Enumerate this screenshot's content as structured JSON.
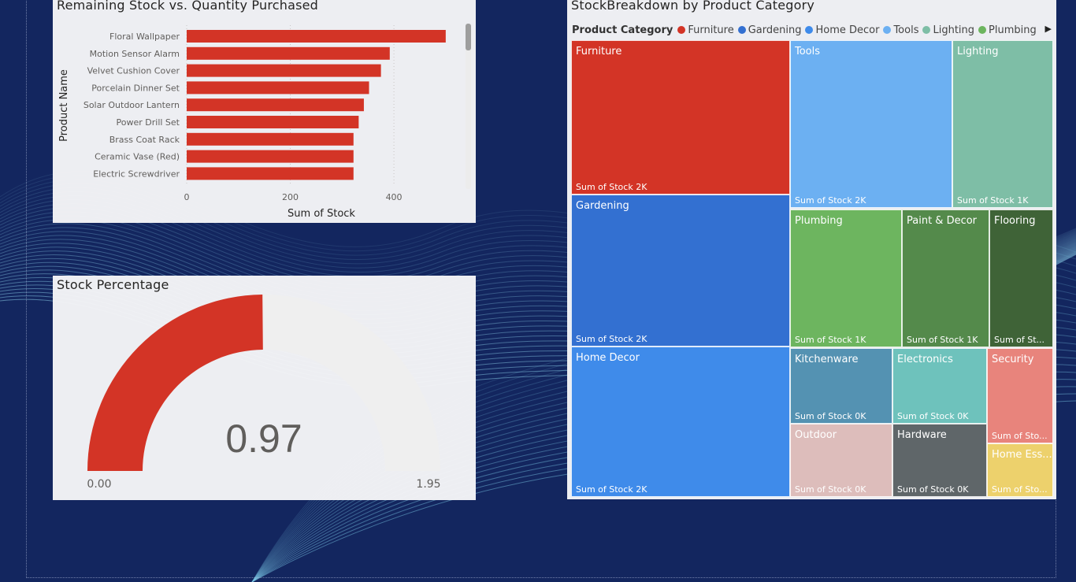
{
  "bar_chart": {
    "title": "Remaining Stock vs. Quantity Purchased",
    "xlabel": "Sum of Stock",
    "ylabel": "Product Name"
  },
  "gauge": {
    "title": "Stock Percentage",
    "value_label": "0.97",
    "min_label": "0.00",
    "max_label": "1.95"
  },
  "treemap": {
    "title": "StockBreakdown by Product Category",
    "legend_title": "Product Category"
  },
  "colors": {
    "bar": "#d33426",
    "gauge_fill": "#d33426",
    "gauge_track": "#efefef"
  },
  "chart_data": [
    {
      "type": "bar",
      "orientation": "horizontal",
      "title": "Remaining Stock vs. Quantity Purchased",
      "xlabel": "Sum of Stock",
      "ylabel": "Product Name",
      "categories": [
        "Floral Wallpaper",
        "Motion Sensor Alarm",
        "Velvet Cushion Cover",
        "Porcelain Dinner Set",
        "Solar Outdoor Lantern",
        "Power Drill Set",
        "Brass Coat Rack",
        "Ceramic Vase (Red)",
        "Electric Screwdriver"
      ],
      "values": [
        500,
        392,
        375,
        352,
        342,
        332,
        322,
        322,
        322
      ],
      "xticks": [
        0,
        200,
        400
      ],
      "xlim": [
        0,
        520
      ],
      "color": "#d33426",
      "grid": "vertical dotted"
    },
    {
      "type": "gauge",
      "title": "Stock Percentage",
      "value": 0.97,
      "min": 0.0,
      "max": 1.95
    },
    {
      "type": "treemap",
      "title": "StockBreakdown by Product Category",
      "legend_title": "Product Category",
      "legend": [
        {
          "name": "Furniture",
          "color": "#d33426"
        },
        {
          "name": "Gardening",
          "color": "#3370d1"
        },
        {
          "name": "Home Decor",
          "color": "#3f8bea"
        },
        {
          "name": "Tools",
          "color": "#6cb0f2"
        },
        {
          "name": "Lighting",
          "color": "#7ebea6"
        },
        {
          "name": "Plumbing",
          "color": "#6db55f"
        }
      ],
      "tiles": [
        {
          "name": "Furniture",
          "label": "Sum of Stock 2K",
          "color": "#d33426"
        },
        {
          "name": "Gardening",
          "label": "Sum of Stock 2K",
          "color": "#3370d1"
        },
        {
          "name": "Home Decor",
          "label": "Sum of Stock 2K",
          "color": "#3f8bea"
        },
        {
          "name": "Tools",
          "label": "Sum of Stock 2K",
          "color": "#6cb0f2"
        },
        {
          "name": "Lighting",
          "label": "Sum of Stock 1K",
          "color": "#7ebea6"
        },
        {
          "name": "Plumbing",
          "label": "Sum of Stock 1K",
          "color": "#6db55f"
        },
        {
          "name": "Paint & Decor",
          "label": "Sum of Stock 1K",
          "color": "#548a4b"
        },
        {
          "name": "Flooring",
          "label": "Sum of St...",
          "color": "#3f6337"
        },
        {
          "name": "Kitchenware",
          "label": "Sum of Stock 0K",
          "color": "#5492b2"
        },
        {
          "name": "Electronics",
          "label": "Sum of Stock 0K",
          "color": "#6ec2bc"
        },
        {
          "name": "Security",
          "label": "Sum of Sto...",
          "color": "#e8847c"
        },
        {
          "name": "Outdoor",
          "label": "Sum of Stock 0K",
          "color": "#ddbdbb"
        },
        {
          "name": "Hardware",
          "label": "Sum of Stock 0K",
          "color": "#5f6669"
        },
        {
          "name": "Home Ess...",
          "label": "Sum of Sto...",
          "color": "#edd16c"
        }
      ]
    }
  ]
}
